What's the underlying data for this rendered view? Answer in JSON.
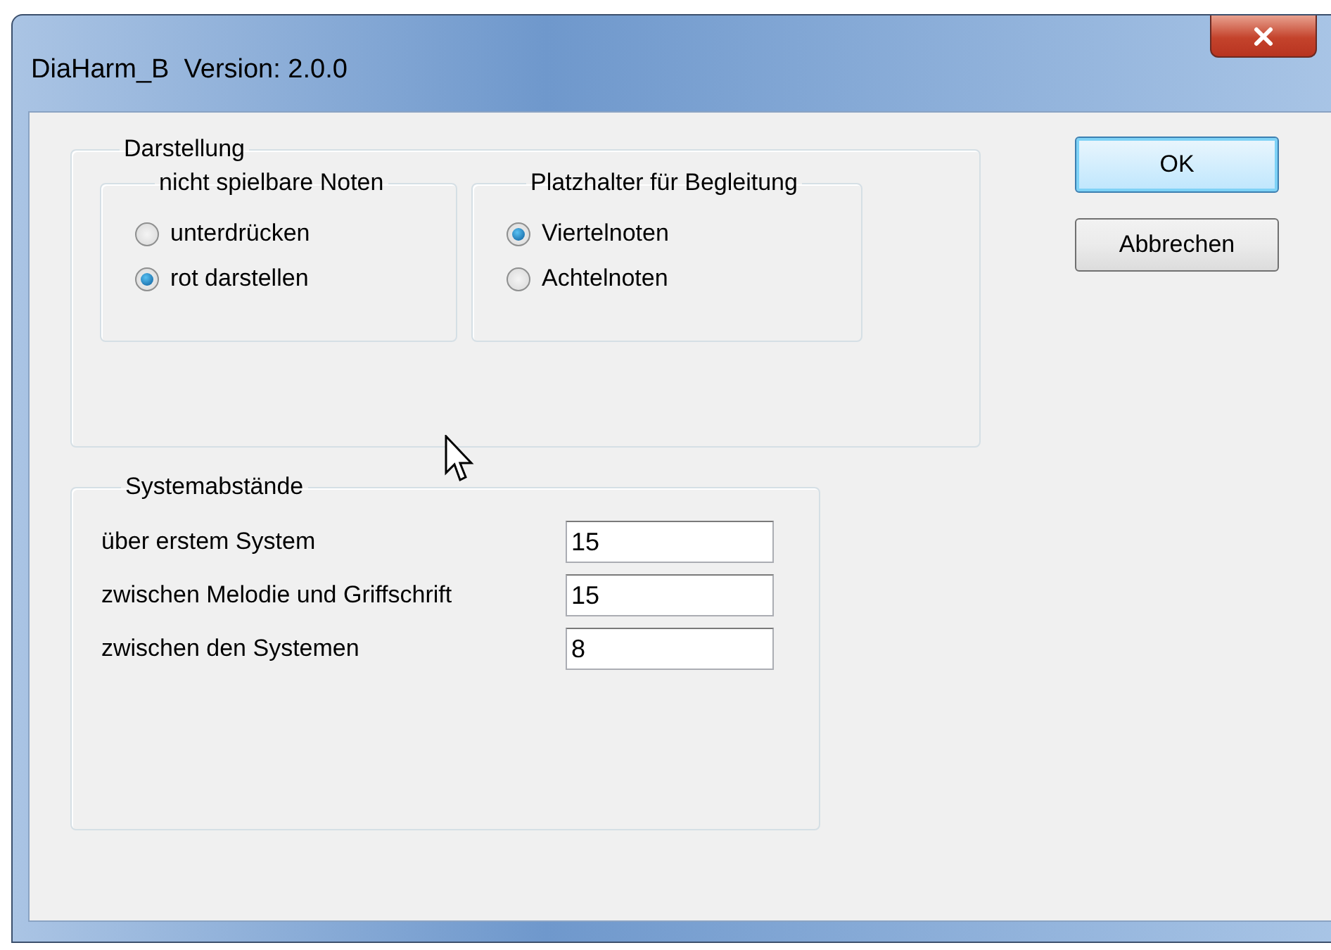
{
  "window": {
    "title": "DiaHarm_B  Version: 2.0.0"
  },
  "display": {
    "title": "Darstellung",
    "groups": [
      {
        "title": "nicht spielbare Noten",
        "options": [
          {
            "label": "unterdrücken",
            "selected": false
          },
          {
            "label": "rot darstellen",
            "selected": true
          }
        ]
      },
      {
        "title": "Platzhalter für Begleitung",
        "options": [
          {
            "label": "Viertelnoten",
            "selected": true
          },
          {
            "label": "Achtelnoten",
            "selected": false
          }
        ]
      }
    ]
  },
  "spacing": {
    "title": "Systemabstände",
    "fields": [
      {
        "label": "über erstem System",
        "value": "15"
      },
      {
        "label": "zwischen Melodie und Griffschrift",
        "value": "15"
      },
      {
        "label": "zwischen den Systemen",
        "value": "8"
      }
    ]
  },
  "buttons": [
    {
      "label": "OK",
      "default": true
    },
    {
      "label": "Abbrechen",
      "default": false
    }
  ]
}
